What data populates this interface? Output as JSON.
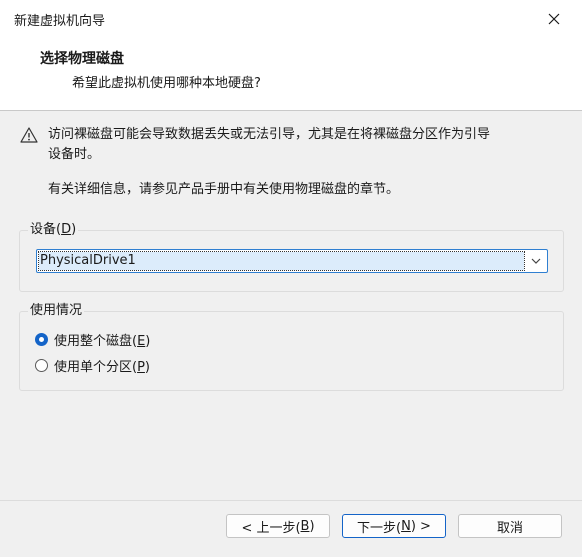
{
  "window": {
    "title": "新建虚拟机向导"
  },
  "header": {
    "title": "选择物理磁盘",
    "subtitle": "希望此虚拟机使用哪种本地硬盘?"
  },
  "warning": {
    "icon": "warning-icon",
    "line1": "访问裸磁盘可能会导致数据丢失或无法引导，尤其是在将裸磁盘分区作为引导",
    "line2": "设备时。"
  },
  "info": {
    "text": "有关详细信息，请参见产品手册中有关使用物理磁盘的章节。"
  },
  "device": {
    "legend_prefix": "设备(",
    "legend_key": "D",
    "legend_suffix": ")",
    "selected": "PhysicalDrive1"
  },
  "usage": {
    "legend": "使用情况",
    "options": [
      {
        "prefix": "使用整个磁盘(",
        "key": "E",
        "suffix": ")",
        "checked": true
      },
      {
        "prefix": "使用单个分区(",
        "key": "P",
        "suffix": ")",
        "checked": false
      }
    ]
  },
  "buttons": {
    "back_prefix": "< 上一步(",
    "back_key": "B",
    "back_suffix": ")",
    "next_prefix": "下一步(",
    "next_key": "N",
    "next_suffix": ") >",
    "cancel": "取消"
  },
  "colors": {
    "accent": "#1464c8",
    "selection": "#dcecfb",
    "background": "#f0f0f0"
  }
}
